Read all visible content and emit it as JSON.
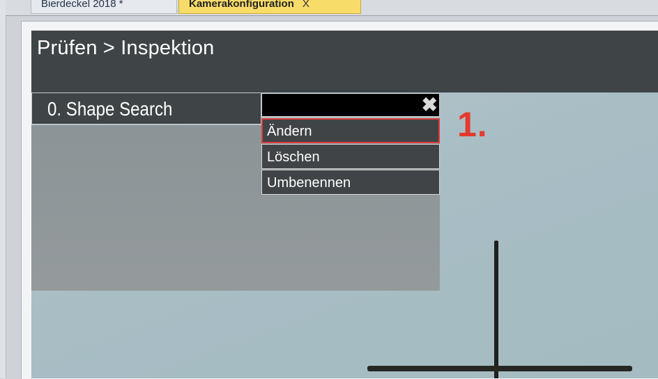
{
  "tabs": [
    {
      "label": "Bierdeckel 2018 *"
    },
    {
      "label": "Kamerakonfiguration",
      "close": "X"
    }
  ],
  "header": {
    "breadcrumb": "Prüfen > Inspektion"
  },
  "panel": {
    "title": "0. Shape Search"
  },
  "popup": {
    "name_value": "",
    "close_icon": "close-icon",
    "items": [
      "Ändern",
      "Löschen",
      "Umbenennen"
    ]
  },
  "annotation": {
    "label": "1."
  },
  "colors": {
    "header_bg": "#3f4547",
    "menu_bg": "#404446",
    "highlight": "#e03c3c",
    "annotation": "#e33b2d",
    "active_tab": "#f7dc6a"
  }
}
